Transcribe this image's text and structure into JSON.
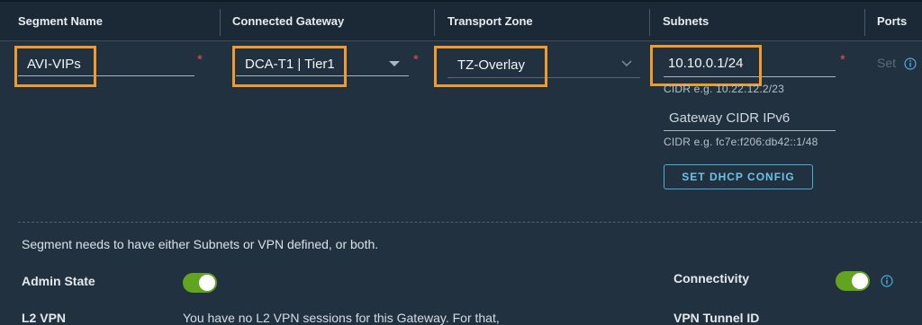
{
  "table": {
    "headers": {
      "segment_name": "Segment Name",
      "connected_gateway": "Connected Gateway",
      "transport_zone": "Transport Zone",
      "subnets": "Subnets",
      "ports": "Ports"
    },
    "row": {
      "segment_name": "AVI-VIPs",
      "connected_gateway": "DCA-T1 | Tier1",
      "transport_zone": "TZ-Overlay",
      "subnet_value": "10.10.0.1/24",
      "subnet_hint": "CIDR e.g. 10.22.12.2/23",
      "ipv6_placeholder": "Gateway CIDR IPv6",
      "ipv6_hint": "CIDR e.g. fc7e:f206:db42::1/48",
      "dhcp_button": "SET DHCP CONFIG",
      "ports_set": "Set",
      "required_mark": "*"
    }
  },
  "details": {
    "note": "Segment needs to have either Subnets or VPN defined, or both.",
    "admin_state_label": "Admin State",
    "admin_state_on": true,
    "connectivity_label": "Connectivity",
    "connectivity_on": true,
    "l2vpn_label": "L2 VPN",
    "l2vpn_text": "You have no L2 VPN sessions for this Gateway. For that,",
    "vpn_tunnel_label": "VPN Tunnel ID"
  },
  "colors": {
    "background": "#22313f",
    "header": "#1b2835",
    "highlight": "#f29b2d",
    "toggle_on": "#62a420",
    "link": "#49afd9",
    "required": "#e8504a"
  },
  "icons": {
    "dropdown": "caret-down-icon",
    "transport_dropdown": "chevron-down-icon",
    "info": "info-circle-icon"
  }
}
